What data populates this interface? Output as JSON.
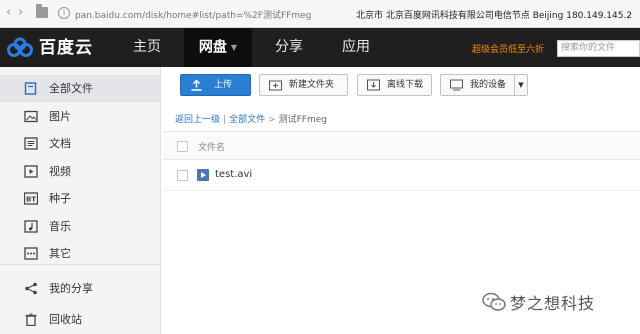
{
  "browser": {
    "url": "pan.baidu.com/disk/home#list/path=%2F测试FFmeg",
    "location_info": "北京市 北京百度网讯科技有限公司电信节点   Beijing   180.149.145.2"
  },
  "topnav": {
    "logo_text": "百度云",
    "items": [
      {
        "label": "主页"
      },
      {
        "label": "网盘"
      },
      {
        "label": "分享"
      },
      {
        "label": "应用"
      }
    ],
    "active_item": "网盘",
    "promo": "超级会员低至六折",
    "search_placeholder": "搜索你的文件"
  },
  "sidebar": {
    "items": [
      {
        "label": "全部文件",
        "icon": "file-icon"
      },
      {
        "label": "图片",
        "icon": "image-icon"
      },
      {
        "label": "文档",
        "icon": "document-icon"
      },
      {
        "label": "视频",
        "icon": "video-icon"
      },
      {
        "label": "种子",
        "icon": "bt-icon"
      },
      {
        "label": "音乐",
        "icon": "music-icon"
      },
      {
        "label": "其它",
        "icon": "more-icon"
      },
      {
        "label": "我的分享",
        "icon": "share-icon"
      },
      {
        "label": "回收站",
        "icon": "trash-icon"
      }
    ],
    "active_item": "全部文件"
  },
  "toolbar": {
    "upload": "上传",
    "new_folder": "新建文件夹",
    "offline_download": "离线下载",
    "my_devices": "我的设备"
  },
  "breadcrumb": {
    "back": "返回上一级",
    "all_files": "全部文件",
    "separator": ">",
    "current": "测试FFmeg"
  },
  "file_list": {
    "column_name": "文件名",
    "files": [
      {
        "name": "test.avi",
        "type": "video"
      }
    ]
  },
  "watermark": {
    "text": "梦之想科技"
  },
  "colors": {
    "primary": "#2a7fd4",
    "topnav_bg": "#1f1f1f",
    "promo": "#ff8a00",
    "link": "#2a72c9"
  }
}
